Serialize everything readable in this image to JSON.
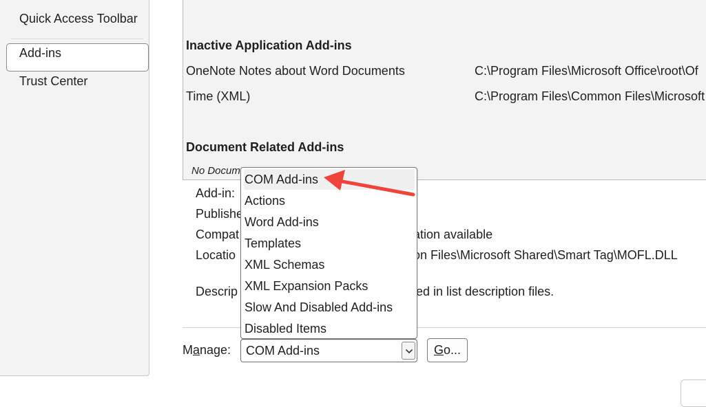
{
  "sidebar": {
    "items": [
      {
        "label": "Quick Access Toolbar"
      },
      {
        "label": "Add-ins"
      },
      {
        "label": "Trust Center"
      }
    ]
  },
  "addins": {
    "inactive_title": "Inactive Application Add-ins",
    "inactive_rows": [
      {
        "name": "OneNote Notes about Word Documents",
        "location": "C:\\Program Files\\Microsoft Office\\root\\Of"
      },
      {
        "name": "Time (XML)",
        "location": "C:\\Program Files\\Common Files\\Microsoft"
      }
    ],
    "document_title": "Document Related Add-ins",
    "document_empty": "No Docum"
  },
  "details": {
    "addin_label": "Add-in:",
    "publisher_label": "Publishe",
    "compat_label": "Compat",
    "compat_value": "ation available",
    "location_label": "Locatio",
    "location_value": "on Files\\Microsoft Shared\\Smart Tag\\MOFL.DLL",
    "description_label": "Descrip",
    "description_value": "ied in list description files."
  },
  "manage": {
    "label_prefix": "M",
    "label_underlined": "a",
    "label_suffix": "nage:",
    "selected": "COM Add-ins",
    "go_underlined": "G",
    "go_suffix": "o...",
    "options": [
      "COM Add-ins",
      "Actions",
      "Word Add-ins",
      "Templates",
      "XML Schemas",
      "XML Expansion Packs",
      "Slow And Disabled Add-ins",
      "Disabled Items"
    ]
  },
  "colors": {
    "annotation_arrow": "#f0433a"
  }
}
